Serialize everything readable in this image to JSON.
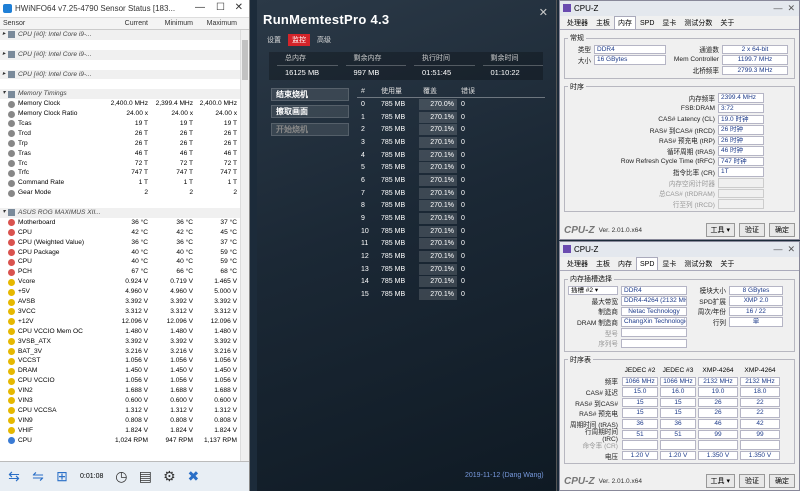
{
  "hwinfo": {
    "title": "HWiNFO64 v7.25-4790 Sensor Status [183...",
    "columns": [
      "Sensor",
      "Current",
      "Minimum",
      "Maximum"
    ],
    "rows": [
      {
        "t": "grp",
        "n": "CPU [#0]: Intel Core i9-...",
        "cur": "",
        "min": "",
        "max": "",
        "exp": ">"
      },
      {
        "t": "blank"
      },
      {
        "t": "grp",
        "n": "CPU [#0]: Intel Core i9-...",
        "cur": "",
        "min": "",
        "max": "",
        "exp": ">"
      },
      {
        "t": "blank"
      },
      {
        "t": "grp",
        "n": "CPU [#0]: Intel Core i9-...",
        "cur": "",
        "min": "",
        "max": "",
        "exp": ">"
      },
      {
        "t": "blank"
      },
      {
        "t": "grp",
        "n": "Memory Timings",
        "cur": "",
        "min": "",
        "max": "",
        "exp": "v"
      },
      {
        "t": "s",
        "n": "Memory Clock",
        "cur": "2,400.0 MHz",
        "min": "2,399.4 MHz",
        "max": "2,400.0 MHz"
      },
      {
        "t": "s",
        "n": "Memory Clock Ratio",
        "cur": "24.00 x",
        "min": "24.00 x",
        "max": "24.00 x"
      },
      {
        "t": "s",
        "n": "Tcas",
        "cur": "19 T",
        "min": "19 T",
        "max": "19 T"
      },
      {
        "t": "s",
        "n": "Trcd",
        "cur": "26 T",
        "min": "26 T",
        "max": "26 T"
      },
      {
        "t": "s",
        "n": "Trp",
        "cur": "26 T",
        "min": "26 T",
        "max": "26 T"
      },
      {
        "t": "s",
        "n": "Tras",
        "cur": "46 T",
        "min": "46 T",
        "max": "46 T"
      },
      {
        "t": "s",
        "n": "Trc",
        "cur": "72 T",
        "min": "72 T",
        "max": "72 T"
      },
      {
        "t": "s",
        "n": "Trfc",
        "cur": "747 T",
        "min": "747 T",
        "max": "747 T"
      },
      {
        "t": "s",
        "n": "Command Rate",
        "cur": "1 T",
        "min": "1 T",
        "max": "1 T"
      },
      {
        "t": "s",
        "n": "Gear Mode",
        "cur": "2",
        "min": "2",
        "max": "2"
      },
      {
        "t": "blank"
      },
      {
        "t": "grp",
        "n": "ASUS ROG MAXIMUS XII...",
        "cur": "",
        "min": "",
        "max": "",
        "exp": "v"
      },
      {
        "t": "s",
        "n": "Motherboard",
        "cur": "36 °C",
        "min": "36 °C",
        "max": "37 °C"
      },
      {
        "t": "s",
        "n": "CPU",
        "cur": "42 °C",
        "min": "42 °C",
        "max": "45 °C"
      },
      {
        "t": "s",
        "n": "CPU (Weighted Value)",
        "cur": "36 °C",
        "min": "36 °C",
        "max": "37 °C"
      },
      {
        "t": "s",
        "n": "CPU Package",
        "cur": "40 °C",
        "min": "40 °C",
        "max": "59 °C"
      },
      {
        "t": "s",
        "n": "CPU",
        "cur": "40 °C",
        "min": "40 °C",
        "max": "59 °C"
      },
      {
        "t": "s",
        "n": "PCH",
        "cur": "67 °C",
        "min": "66 °C",
        "max": "68 °C"
      },
      {
        "t": "s",
        "n": "Vcore",
        "cur": "0.924 V",
        "min": "0.719 V",
        "max": "1.465 V"
      },
      {
        "t": "s",
        "n": "+5V",
        "cur": "4.960 V",
        "min": "4.960 V",
        "max": "5.000 V"
      },
      {
        "t": "s",
        "n": "AVSB",
        "cur": "3.392 V",
        "min": "3.392 V",
        "max": "3.392 V"
      },
      {
        "t": "s",
        "n": "3VCC",
        "cur": "3.312 V",
        "min": "3.312 V",
        "max": "3.312 V"
      },
      {
        "t": "s",
        "n": "+12V",
        "cur": "12.096 V",
        "min": "12.096 V",
        "max": "12.096 V"
      },
      {
        "t": "s",
        "n": "CPU VCCIO Mem OC",
        "cur": "1.480 V",
        "min": "1.480 V",
        "max": "1.480 V"
      },
      {
        "t": "s",
        "n": "3VSB_ATX",
        "cur": "3.392 V",
        "min": "3.392 V",
        "max": "3.392 V"
      },
      {
        "t": "s",
        "n": "BAT_3V",
        "cur": "3.216 V",
        "min": "3.216 V",
        "max": "3.216 V"
      },
      {
        "t": "s",
        "n": "VCCST",
        "cur": "1.056 V",
        "min": "1.056 V",
        "max": "1.056 V"
      },
      {
        "t": "s",
        "n": "DRAM",
        "cur": "1.450 V",
        "min": "1.450 V",
        "max": "1.450 V"
      },
      {
        "t": "s",
        "n": "CPU VCCIO",
        "cur": "1.056 V",
        "min": "1.056 V",
        "max": "1.056 V"
      },
      {
        "t": "s",
        "n": "VIN2",
        "cur": "1.688 V",
        "min": "1.688 V",
        "max": "1.688 V"
      },
      {
        "t": "s",
        "n": "VIN3",
        "cur": "0.600 V",
        "min": "0.600 V",
        "max": "0.600 V"
      },
      {
        "t": "s",
        "n": "CPU VCCSA",
        "cur": "1.312 V",
        "min": "1.312 V",
        "max": "1.312 V"
      },
      {
        "t": "s",
        "n": "VIN9",
        "cur": "0.808 V",
        "min": "0.808 V",
        "max": "0.808 V"
      },
      {
        "t": "s",
        "n": "VHIF",
        "cur": "1.824 V",
        "min": "1.824 V",
        "max": "1.824 V"
      },
      {
        "t": "s",
        "n": "CPU",
        "cur": "1,024 RPM",
        "min": "947 RPM",
        "max": "1,137 RPM"
      }
    ],
    "footer_time": "0:01:08"
  },
  "memtest": {
    "title": "RunMemtestPro 4.3",
    "menu": [
      "设置",
      "监控",
      "高级"
    ],
    "stats_labels": [
      "总内存",
      "剩余内存",
      "执行时间",
      "剩余时间"
    ],
    "stats_values": [
      "16125 MB",
      "997 MB",
      "01:51:45",
      "01:10:22"
    ],
    "buttons": [
      "结束烧机",
      "擦取画面",
      "开始烧机"
    ],
    "table_headers": [
      "#",
      "使用量",
      "覆盖",
      "错误"
    ],
    "threads": [
      {
        "i": "0",
        "cap": "785 MB",
        "cov": "270.0%",
        "err": "0"
      },
      {
        "i": "1",
        "cap": "785 MB",
        "cov": "270.1%",
        "err": "0"
      },
      {
        "i": "2",
        "cap": "785 MB",
        "cov": "270.1%",
        "err": "0"
      },
      {
        "i": "3",
        "cap": "785 MB",
        "cov": "270.1%",
        "err": "0"
      },
      {
        "i": "4",
        "cap": "785 MB",
        "cov": "270.1%",
        "err": "0"
      },
      {
        "i": "5",
        "cap": "785 MB",
        "cov": "270.1%",
        "err": "0"
      },
      {
        "i": "6",
        "cap": "785 MB",
        "cov": "270.1%",
        "err": "0"
      },
      {
        "i": "7",
        "cap": "785 MB",
        "cov": "270.1%",
        "err": "0"
      },
      {
        "i": "8",
        "cap": "785 MB",
        "cov": "270.1%",
        "err": "0"
      },
      {
        "i": "9",
        "cap": "785 MB",
        "cov": "270.1%",
        "err": "0"
      },
      {
        "i": "10",
        "cap": "785 MB",
        "cov": "270.1%",
        "err": "0"
      },
      {
        "i": "11",
        "cap": "785 MB",
        "cov": "270.1%",
        "err": "0"
      },
      {
        "i": "12",
        "cap": "785 MB",
        "cov": "270.1%",
        "err": "0"
      },
      {
        "i": "13",
        "cap": "785 MB",
        "cov": "270.1%",
        "err": "0"
      },
      {
        "i": "14",
        "cap": "785 MB",
        "cov": "270.1%",
        "err": "0"
      },
      {
        "i": "15",
        "cap": "785 MB",
        "cov": "270.1%",
        "err": "0"
      }
    ],
    "signature": "2019-11-12 (Dang Wang)"
  },
  "cpuz1": {
    "title": "CPU-Z",
    "tabs": [
      "处理器",
      "主板",
      "内存",
      "SPD",
      "显卡",
      "测试分数",
      "关于"
    ],
    "active_tab": "内存",
    "general_legend": "常规",
    "type_label": "类型",
    "type": "DDR4",
    "channels_label": "通道数",
    "channels": "2 x 64-bit",
    "size_label": "大小",
    "size": "16 GBytes",
    "memctrl_label": "Mem Controller",
    "memctrl": "1199.7 MHz",
    "nb_label": "北桥频率",
    "nb": "2799.3 MHz",
    "timing_legend": "时序",
    "timings": [
      {
        "l": "内存频率",
        "v": "2399.4 MHz",
        "dim": false
      },
      {
        "l": "FSB:DRAM",
        "v": "3:72",
        "dim": false
      },
      {
        "l": "CAS# Latency (CL)",
        "v": "19.0 时钟",
        "dim": false
      },
      {
        "l": "RAS# 到CAS# (tRCD)",
        "v": "26 时钟",
        "dim": false
      },
      {
        "l": "RAS# 预充电 (tRP)",
        "v": "26 时钟",
        "dim": false
      },
      {
        "l": "循环周期 (tRAS)",
        "v": "46 时钟",
        "dim": false
      },
      {
        "l": "Row Refresh Cycle Time (tRFC)",
        "v": "747 时钟",
        "dim": false
      },
      {
        "l": "指令比率 (CR)",
        "v": "1T",
        "dim": false
      },
      {
        "l": "内存空闲计时器",
        "v": "",
        "dim": true
      },
      {
        "l": "总CAS# (tRDRAM)",
        "v": "",
        "dim": true
      },
      {
        "l": "行至列 (tRCD)",
        "v": "",
        "dim": true
      }
    ],
    "brand": "CPU-Z",
    "version": "Ver. 2.01.0.x64",
    "tools": "工具",
    "validate": "验证",
    "ok": "确定"
  },
  "cpuz2": {
    "title": "CPU-Z",
    "tabs": [
      "处理器",
      "主板",
      "内存",
      "SPD",
      "显卡",
      "测试分数",
      "关于"
    ],
    "active_tab": "SPD",
    "slot_legend": "内存插槽选择",
    "slot": "插槽 #2",
    "slot_type": "DDR4",
    "module_size_label": "模块大小",
    "module_size": "8 GBytes",
    "max_bw_label": "最大带宽",
    "max_bw": "DDR4-4264 (2132 MHz)",
    "spd_ext_label": "SPD扩展",
    "spd_ext": "XMP 2.0",
    "mfr_label": "制造商",
    "mfr": "Netac Technology",
    "week_label": "周次/年份",
    "week": "16 / 22",
    "dram_mfr_label": "DRAM 制造商",
    "dram_mfr": "ChangXin Technologies",
    "rank_label": "行列",
    "rank": "单",
    "part_label": "型号",
    "serial_label": "序列号",
    "timing_table_legend": "时序表",
    "col_headers": [
      "JEDEC #2",
      "JEDEC #3",
      "XMP-4264",
      "XMP-4264"
    ],
    "trows": [
      {
        "l": "频率",
        "v": [
          "1066 MHz",
          "1066 MHz",
          "2132 MHz",
          "2132 MHz"
        ]
      },
      {
        "l": "CAS# 延迟",
        "v": [
          "15.0",
          "16.0",
          "19.0",
          "18.0"
        ]
      },
      {
        "l": "RAS# 到CAS#",
        "v": [
          "15",
          "15",
          "26",
          "22"
        ]
      },
      {
        "l": "RAS# 预充电",
        "v": [
          "15",
          "15",
          "26",
          "22"
        ]
      },
      {
        "l": "周期时间 (tRAS)",
        "v": [
          "36",
          "36",
          "46",
          "42"
        ]
      },
      {
        "l": "行周期时间 (tRC)",
        "v": [
          "51",
          "51",
          "99",
          "99"
        ]
      },
      {
        "l": "命令率 (CR)",
        "v": [
          "",
          "",
          "",
          ""
        ]
      },
      {
        "l": "电压",
        "v": [
          "1.20 V",
          "1.20 V",
          "1.350 V",
          "1.350 V"
        ]
      }
    ],
    "brand": "CPU-Z",
    "version": "Ver. 2.01.0.x64",
    "tools": "工具",
    "validate": "验证",
    "ok": "确定"
  }
}
